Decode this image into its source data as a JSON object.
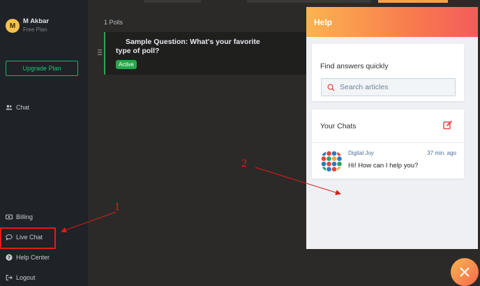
{
  "sidebar": {
    "avatar_letter": "M",
    "user_name": "M Akbar",
    "plan": "Free Plan",
    "upgrade_label": "Upgrade Plan",
    "nav": {
      "chat": "Chat",
      "billing": "Billing",
      "live_chat": "Live Chat",
      "help_center": "Help Center",
      "logout": "Logout"
    }
  },
  "main": {
    "polls_count": "1 Polls",
    "poll": {
      "title": "Sample Question: What's your favorite type of poll?",
      "status": "Active"
    }
  },
  "help": {
    "title": "Help",
    "find_title": "Find answers quickly",
    "search_placeholder": "Search articles",
    "chats_title": "Your Chats",
    "chat": {
      "name": "Digital Joy",
      "time": "37 min. ago",
      "message": "Hi! How can I help you?"
    }
  },
  "annotations": {
    "label_1": "1",
    "label_2": "2"
  },
  "colors": {
    "accent_green": "#1fb16e",
    "annotation_red": "#e31b1b",
    "help_gradient_start": "#fbb44f",
    "help_gradient_end": "#f45b5b"
  },
  "icons": {
    "chat": "users-icon",
    "billing": "card-icon",
    "live_chat": "speech-bubble-icon",
    "help_center": "question-circle-icon",
    "logout": "logout-icon",
    "search": "search-icon",
    "edit": "edit-icon",
    "close": "close-icon"
  }
}
